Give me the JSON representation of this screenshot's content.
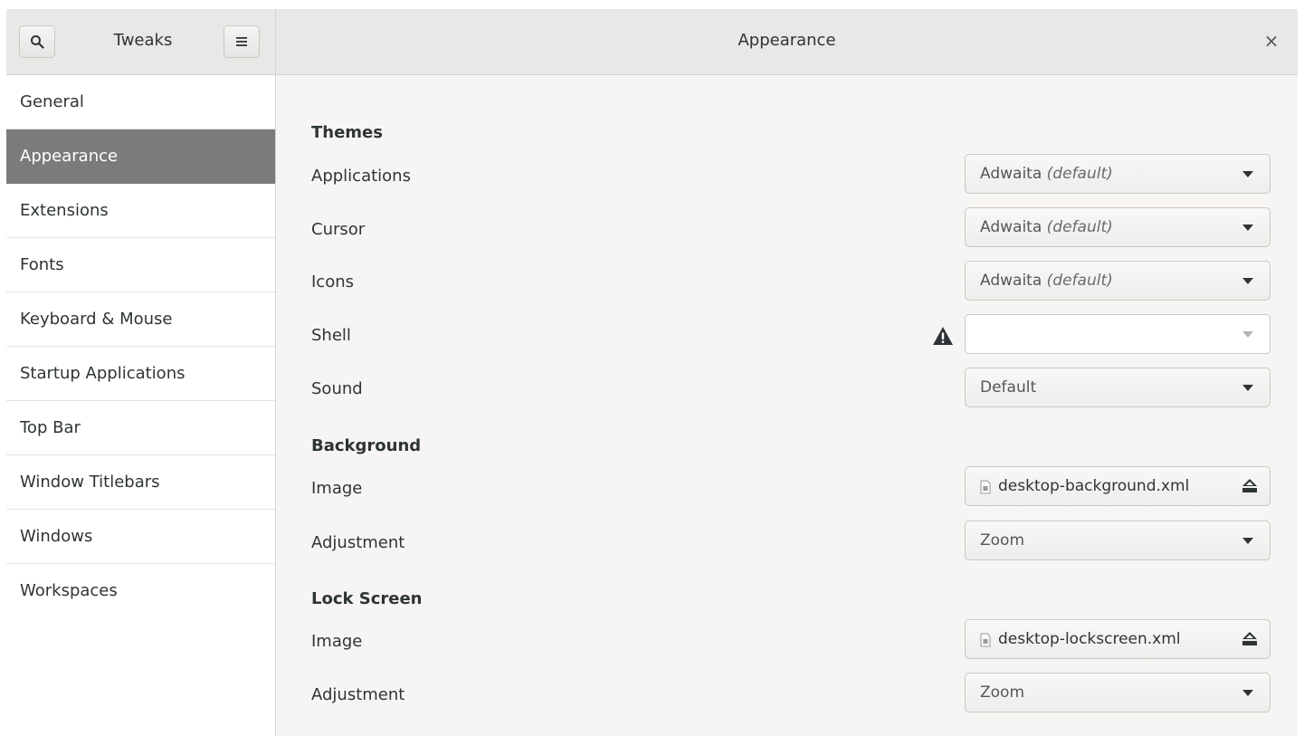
{
  "header": {
    "app_title": "Tweaks",
    "page_title": "Appearance",
    "search_icon": "search-icon",
    "menu_icon": "hamburger-menu-icon",
    "close_glyph": "×"
  },
  "sidebar": {
    "items": [
      {
        "label": "General",
        "active": false
      },
      {
        "label": "Appearance",
        "active": true
      },
      {
        "label": "Extensions",
        "active": false
      },
      {
        "label": "Fonts",
        "active": false
      },
      {
        "label": "Keyboard & Mouse",
        "active": false
      },
      {
        "label": "Startup Applications",
        "active": false
      },
      {
        "label": "Top Bar",
        "active": false
      },
      {
        "label": "Window Titlebars",
        "active": false
      },
      {
        "label": "Windows",
        "active": false
      },
      {
        "label": "Workspaces",
        "active": false
      }
    ]
  },
  "main": {
    "themes": {
      "heading": "Themes",
      "applications": {
        "label": "Applications",
        "value": "Adwaita",
        "suffix": "(default)"
      },
      "cursor": {
        "label": "Cursor",
        "value": "Adwaita",
        "suffix": "(default)"
      },
      "icons": {
        "label": "Icons",
        "value": "Adwaita",
        "suffix": "(default)"
      },
      "shell": {
        "label": "Shell",
        "value": ""
      },
      "sound": {
        "label": "Sound",
        "value": "Default"
      }
    },
    "background": {
      "heading": "Background",
      "image": {
        "label": "Image",
        "file": "desktop-background.xml"
      },
      "adjustment": {
        "label": "Adjustment",
        "value": "Zoom"
      }
    },
    "lock_screen": {
      "heading": "Lock Screen",
      "image": {
        "label": "Image",
        "file": "desktop-lockscreen.xml"
      },
      "adjustment": {
        "label": "Adjustment",
        "value": "Zoom"
      }
    }
  },
  "colors": {
    "sidebar_active_bg": "#7b7b7b",
    "header_bg": "#e8e8e7",
    "content_bg": "#f6f5f4"
  }
}
